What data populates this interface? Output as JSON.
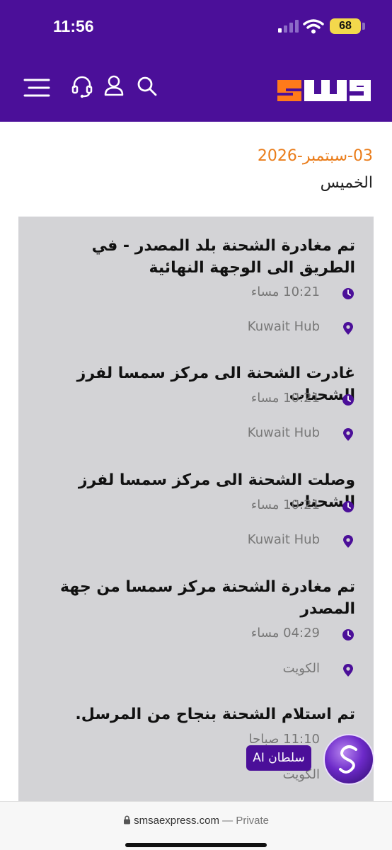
{
  "status_bar": {
    "time": "11:56",
    "battery": "68"
  },
  "header": {
    "brand_text": "سمسا",
    "icons": [
      "menu-icon",
      "headset-icon",
      "user-icon",
      "search-icon"
    ],
    "accent": "#4b0f99",
    "logo_orange": "#ff7a1a"
  },
  "timeline": {
    "date": "03-سبتمبر-2026",
    "day": "الخميس",
    "events": [
      {
        "title": "تم مغادرة الشحنة بلد المصدر - في الطريق الى الوجهة النهائية",
        "time": "10:21 مساء",
        "location": "Kuwait Hub"
      },
      {
        "title": "غادرت الشحنة الى مركز سمسا لفرز الشحنات",
        "time": "10:21 مساء",
        "location": "Kuwait Hub"
      },
      {
        "title": "وصلت الشحنة الى مركز سمسا لفرز الشحنات",
        "time": "10:21 مساء",
        "location": "Kuwait Hub"
      },
      {
        "title": "تم مغادرة الشحنة مركز سمسا من جهة المصدر",
        "time": "04:29 مساء",
        "location": "الكويت"
      },
      {
        "title": "تم استلام الشحنة بنجاح من المرسل.",
        "time": "11:10 صباحا",
        "location": "الكويت"
      }
    ]
  },
  "assistant": {
    "label": "سلطان AI"
  },
  "browser": {
    "domain": "smsaexpress.com",
    "separator": "—",
    "mode": "Private"
  }
}
